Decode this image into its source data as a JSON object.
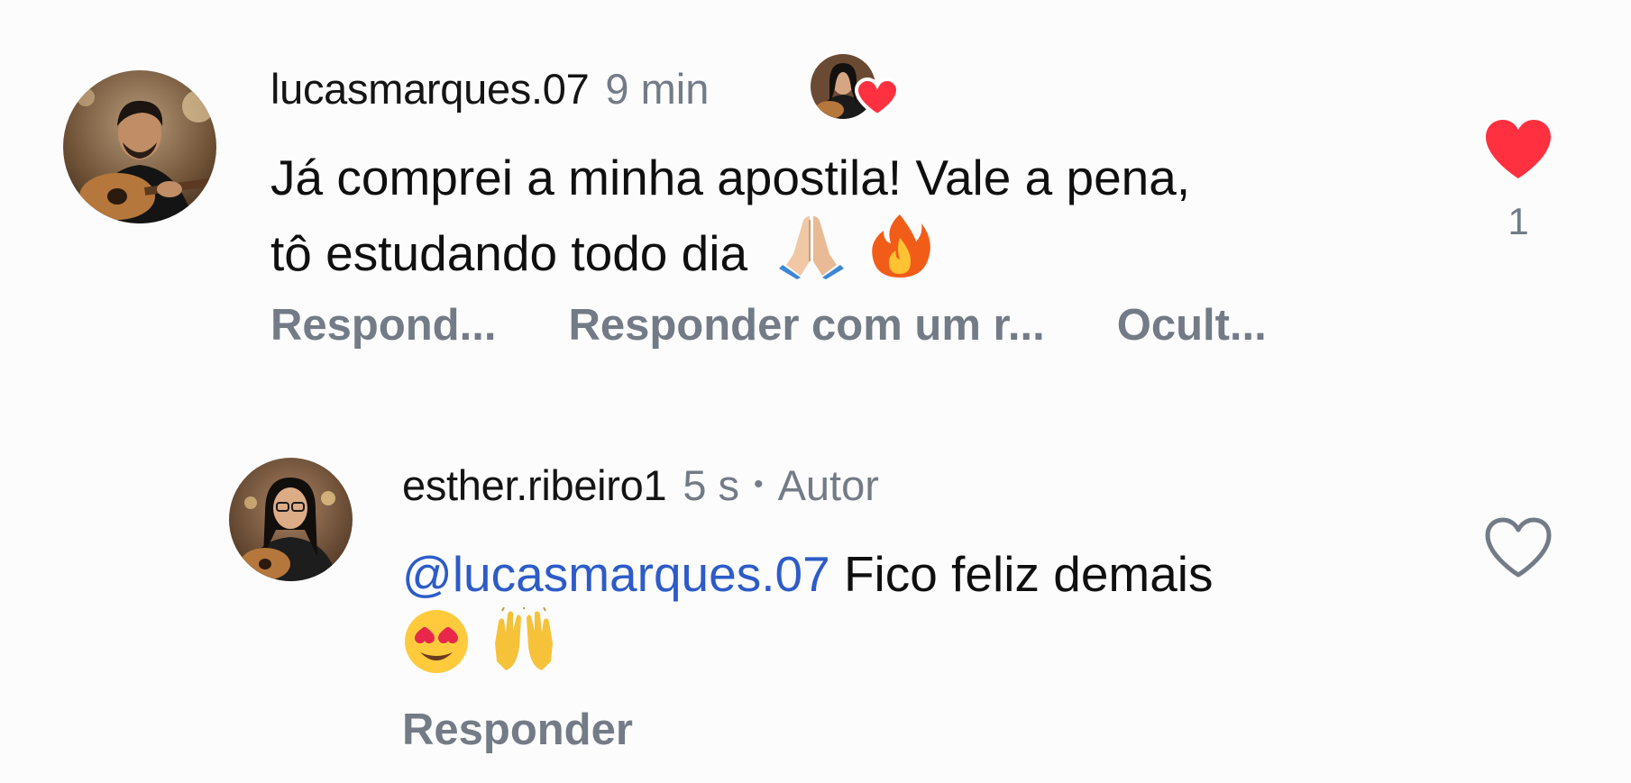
{
  "comments": [
    {
      "username": "lucasmarques.07",
      "time": "9 min",
      "text_line1": "Já comprei a minha apostila! Vale a pena,",
      "text_line2": "tô estudando todo dia",
      "emojis": [
        "folded-hands-emoji",
        "fire-emoji"
      ],
      "liked": true,
      "like_count": "1",
      "actions": [
        "Respond...",
        "Responder com um r...",
        "Ocult..."
      ],
      "author_liked_badge": true
    },
    {
      "username": "esther.ribeiro1",
      "time": "5 s",
      "separator": "•",
      "author_tag": "Autor",
      "mention": "@lucasmarques.07",
      "text": "Fico feliz demais",
      "emojis": [
        "heart-eyes-emoji",
        "raising-hands-emoji"
      ],
      "liked": false,
      "actions": [
        "Responder"
      ]
    }
  ],
  "colors": {
    "like_red": "#ff3040",
    "muted_gray": "#737b86",
    "mention_blue": "#2d5cc8"
  }
}
